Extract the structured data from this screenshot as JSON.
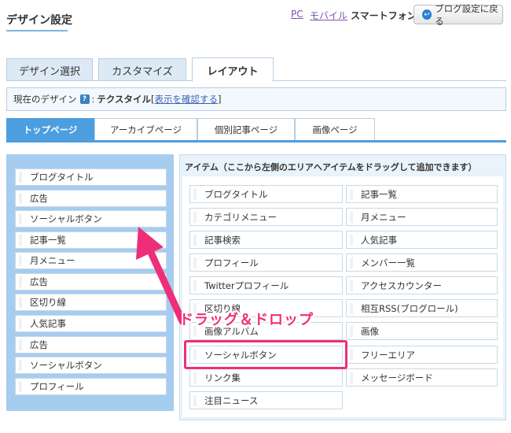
{
  "header": {
    "title": "デザイン設定",
    "devices": {
      "pc": "PC",
      "mobile": "モバイル",
      "smartphone": "スマートフォン"
    },
    "back_button": "ブログ設定に戻る"
  },
  "main_tabs": [
    "デザイン選択",
    "カスタマイズ",
    "レイアウト"
  ],
  "current_design": {
    "label": "現在のデザイン",
    "help": "?",
    "separator": ":",
    "name": "テクスタイル",
    "link_open": "[",
    "link_text": "表示を確認する",
    "link_close": "]"
  },
  "sub_tabs": [
    "トップページ",
    "アーカイブページ",
    "個別記事ページ",
    "画像ページ"
  ],
  "layout_items": [
    "ブログタイトル",
    "広告",
    "ソーシャルボタン",
    "記事一覧",
    "月メニュー",
    "広告",
    "区切り線",
    "人気記事",
    "広告",
    "ソーシャルボタン",
    "プロフィール"
  ],
  "items_panel": {
    "title": "アイテム（ここから左側のエリアへアイテムをドラッグして追加できます）",
    "left": [
      "ブログタイトル",
      "カテゴリメニュー",
      "記事検索",
      "プロフィール",
      "Twitterプロフィール",
      "区切り線",
      "画像アルバム",
      "ソーシャルボタン",
      "リンク集",
      "注目ニュース"
    ],
    "right": [
      "記事一覧",
      "月メニュー",
      "人気記事",
      "メンバー一覧",
      "アクセスカウンター",
      "相互RSS(ブログロール)",
      "画像",
      "フリーエリア",
      "メッセージボード"
    ]
  },
  "annotation": {
    "label": "ドラッグ＆ドロップ",
    "color": "#ef2e78"
  },
  "colors": {
    "accent": "#4d9edf",
    "panel": "#a6cdf0",
    "tab_bg": "#dde9f5"
  }
}
